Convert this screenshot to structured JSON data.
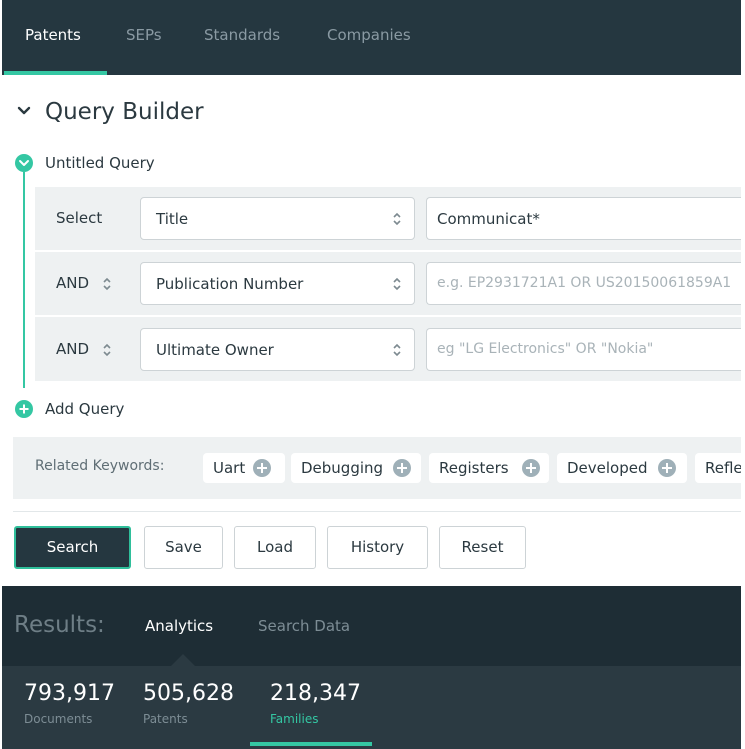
{
  "nav": {
    "tabs": [
      {
        "label": "Patents",
        "active": true
      },
      {
        "label": "SEPs",
        "active": false
      },
      {
        "label": "Standards",
        "active": false
      },
      {
        "label": "Companies",
        "active": false
      }
    ]
  },
  "query_builder": {
    "title": "Query Builder",
    "query_name": "Untitled Query",
    "rows": [
      {
        "operator": "Select",
        "field": "Title",
        "value": "Communicat*",
        "placeholder": ""
      },
      {
        "operator": "AND",
        "field": "Publication Number",
        "value": "",
        "placeholder": "e.g. EP2931721A1 OR US20150061859A1"
      },
      {
        "operator": "AND",
        "field": "Ultimate Owner",
        "value": "",
        "placeholder": "eg \"LG Electronics\" OR \"Nokia\""
      }
    ],
    "add_query_label": "Add Query"
  },
  "related_keywords": {
    "label": "Related Keywords:",
    "chips": [
      "Uart",
      "Debugging",
      "Registers",
      "Developed",
      "Refle"
    ]
  },
  "actions": {
    "search": "Search",
    "save": "Save",
    "load": "Load",
    "history": "History",
    "reset": "Reset"
  },
  "results": {
    "label": "Results:",
    "tabs": [
      {
        "label": "Analytics",
        "active": true
      },
      {
        "label": "Search Data",
        "active": false
      }
    ],
    "stats": [
      {
        "value": "793,917",
        "label": "Documents",
        "active": false
      },
      {
        "value": "505,628",
        "label": "Patents",
        "active": false
      },
      {
        "value": "218,347",
        "label": "Families",
        "active": true
      }
    ]
  },
  "colors": {
    "nav_bg": "#253740",
    "accent": "#34c7a3",
    "results_bg": "#1e2d35",
    "stats_bg": "#2b3a42"
  },
  "icons": {
    "collapse": "chevron-down-icon",
    "query_toggle": "minus-circle-icon",
    "add": "plus-circle-icon",
    "select_arrows": "sort-arrows-icon"
  }
}
